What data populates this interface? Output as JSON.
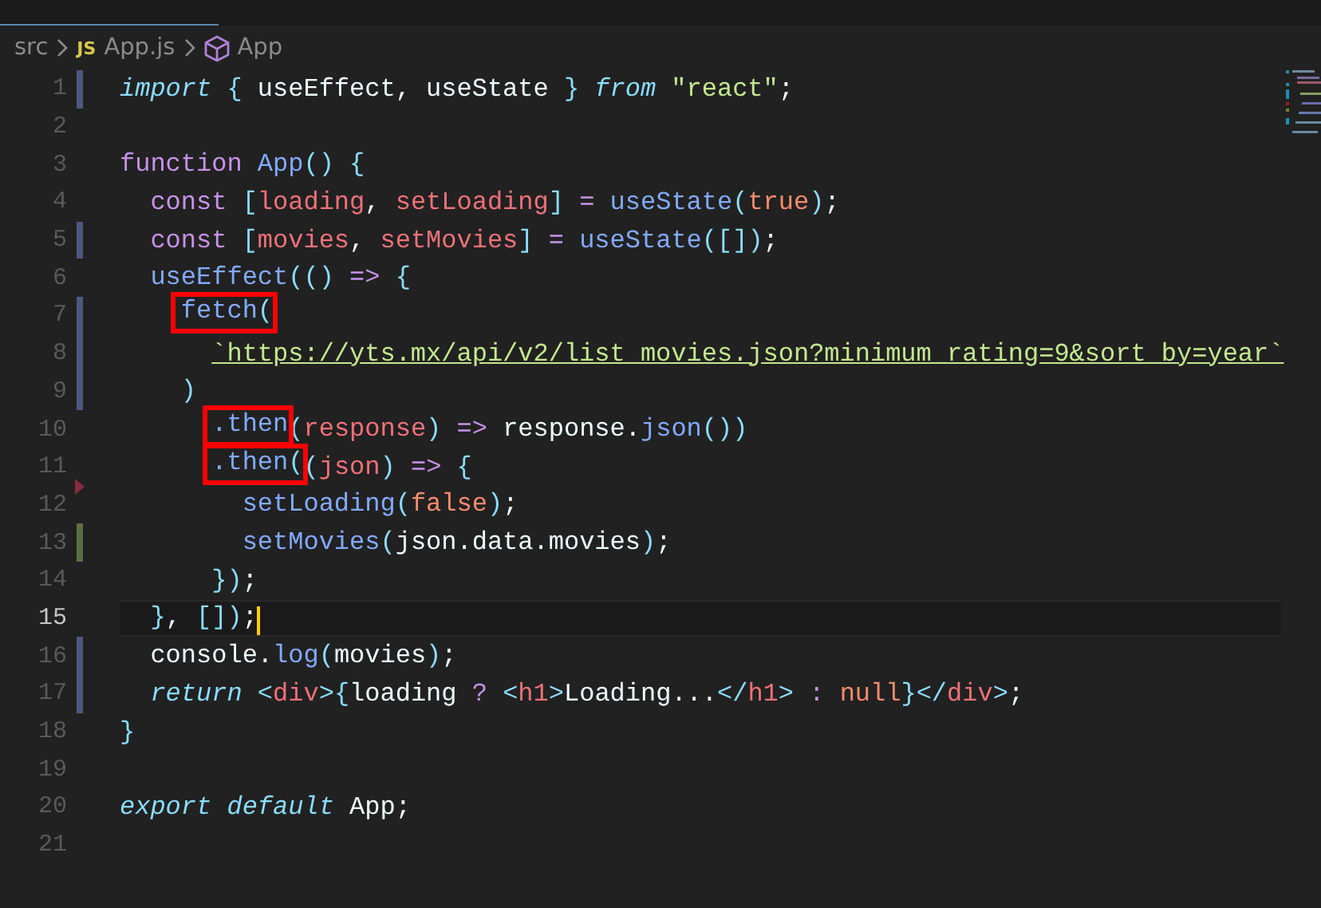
{
  "breadcrumb": [
    {
      "kind": "folder",
      "label": "src"
    },
    {
      "kind": "js-file",
      "icon": "JS",
      "label": "App.js"
    },
    {
      "kind": "component",
      "label": "App"
    }
  ],
  "lines": [
    {
      "number": "1",
      "modified": true,
      "added": false,
      "deleted": false,
      "current": false,
      "segments": [
        {
          "kind": "kw",
          "text": "import "
        },
        {
          "kind": "br",
          "text": "{ "
        },
        {
          "kind": "p",
          "text": "useEffect, useState "
        },
        {
          "kind": "br",
          "text": "} "
        },
        {
          "kind": "kw",
          "text": "from "
        },
        {
          "kind": "str",
          "text": "\"react\""
        },
        {
          "kind": "p",
          "text": ";"
        }
      ]
    },
    {
      "number": "2",
      "modified": false,
      "added": false,
      "deleted": false,
      "current": false
    },
    {
      "number": "3",
      "modified": false,
      "added": false,
      "deleted": false,
      "current": false,
      "segments": [
        {
          "kind": "st",
          "text": "function "
        },
        {
          "kind": "fn",
          "text": "App"
        },
        {
          "kind": "br",
          "text": "() {"
        }
      ]
    },
    {
      "number": "4",
      "modified": false,
      "added": false,
      "deleted": false,
      "current": false,
      "segments": [
        {
          "kind": "st",
          "text": "  const "
        },
        {
          "kind": "br",
          "text": "["
        },
        {
          "kind": "var",
          "text": "loading"
        },
        {
          "kind": "p",
          "text": ", "
        },
        {
          "kind": "var",
          "text": "setLoading"
        },
        {
          "kind": "br",
          "text": "]"
        },
        {
          "kind": "op",
          "text": " = "
        },
        {
          "kind": "fn",
          "text": "useState"
        },
        {
          "kind": "br",
          "text": "("
        },
        {
          "kind": "bool",
          "text": "true"
        },
        {
          "kind": "br",
          "text": ")"
        },
        {
          "kind": "p",
          "text": ";"
        }
      ]
    },
    {
      "number": "5",
      "modified": true,
      "added": false,
      "deleted": false,
      "current": false,
      "segments": [
        {
          "kind": "st",
          "text": "  const "
        },
        {
          "kind": "br",
          "text": "["
        },
        {
          "kind": "var",
          "text": "movies"
        },
        {
          "kind": "p",
          "text": ", "
        },
        {
          "kind": "var",
          "text": "setMovies"
        },
        {
          "kind": "br",
          "text": "]"
        },
        {
          "kind": "op",
          "text": " = "
        },
        {
          "kind": "fn",
          "text": "useState"
        },
        {
          "kind": "br",
          "text": "([])"
        },
        {
          "kind": "p",
          "text": ";"
        }
      ]
    },
    {
      "number": "6",
      "modified": false,
      "added": false,
      "deleted": false,
      "current": false,
      "segments": [
        {
          "kind": "fn",
          "text": "  useEffect"
        },
        {
          "kind": "br",
          "text": "(()"
        },
        {
          "kind": "op",
          "text": " => "
        },
        {
          "kind": "br",
          "text": "{"
        }
      ]
    },
    {
      "number": "7",
      "modified": true,
      "added": false,
      "deleted": false,
      "current": false,
      "boxed_segments": [
        {
          "kind": "fn",
          "text": "    fetch"
        },
        {
          "kind": "br",
          "text": "("
        }
      ]
    },
    {
      "number": "8",
      "modified": true,
      "added": false,
      "deleted": false,
      "current": false,
      "segments": [
        {
          "kind": "link",
          "text": "      `https://yts.mx/api/v2/list_movies.json?minimum_rating=9&sort_by=year`"
        }
      ]
    },
    {
      "number": "9",
      "modified": true,
      "added": false,
      "deleted": false,
      "current": false,
      "segments": [
        {
          "kind": "br",
          "text": "    )"
        }
      ]
    },
    {
      "number": "10",
      "modified": false,
      "added": false,
      "deleted": false,
      "current": false,
      "boxed_segments": [
        {
          "kind": "fn",
          "text": "      .then"
        }
      ],
      "after_segments": [
        {
          "kind": "br",
          "text": "("
        },
        {
          "kind": "var",
          "text": "response"
        },
        {
          "kind": "br",
          "text": ")"
        },
        {
          "kind": "op",
          "text": " => "
        },
        {
          "kind": "p",
          "text": "response."
        },
        {
          "kind": "fn",
          "text": "json"
        },
        {
          "kind": "br",
          "text": "())"
        }
      ]
    },
    {
      "number": "11",
      "modified": false,
      "added": false,
      "deleted": true,
      "current": false,
      "boxed_segments": [
        {
          "kind": "fn",
          "text": "      .then"
        },
        {
          "kind": "br",
          "text": "("
        }
      ],
      "after_segments": [
        {
          "kind": "br",
          "text": "("
        },
        {
          "kind": "var",
          "text": "json"
        },
        {
          "kind": "br",
          "text": ")"
        },
        {
          "kind": "op",
          "text": " => "
        },
        {
          "kind": "br",
          "text": "{"
        }
      ]
    },
    {
      "number": "12",
      "modified": false,
      "added": false,
      "deleted": false,
      "current": false,
      "segments": [
        {
          "kind": "fn",
          "text": "        setLoading"
        },
        {
          "kind": "br",
          "text": "("
        },
        {
          "kind": "bool",
          "text": "false"
        },
        {
          "kind": "br",
          "text": ")"
        },
        {
          "kind": "p",
          "text": ";"
        }
      ]
    },
    {
      "number": "13",
      "modified": false,
      "added": true,
      "deleted": false,
      "current": false,
      "segments": [
        {
          "kind": "fn",
          "text": "        setMovies"
        },
        {
          "kind": "br",
          "text": "("
        },
        {
          "kind": "p",
          "text": "json.data.movies"
        },
        {
          "kind": "br",
          "text": ")"
        },
        {
          "kind": "p",
          "text": ";"
        }
      ]
    },
    {
      "number": "14",
      "modified": false,
      "added": false,
      "deleted": false,
      "current": false,
      "segments": [
        {
          "kind": "br",
          "text": "      })"
        },
        {
          "kind": "p",
          "text": ";"
        }
      ]
    },
    {
      "number": "15",
      "modified": false,
      "added": false,
      "deleted": false,
      "current": true,
      "segments": [
        {
          "kind": "br",
          "text": "  }"
        },
        {
          "kind": "p",
          "text": ", "
        },
        {
          "kind": "br",
          "text": "[])"
        },
        {
          "kind": "p",
          "text": ";"
        }
      ]
    },
    {
      "number": "16",
      "modified": true,
      "added": false,
      "deleted": false,
      "current": false,
      "segments": [
        {
          "kind": "p",
          "text": "  console."
        },
        {
          "kind": "fn",
          "text": "log"
        },
        {
          "kind": "br",
          "text": "("
        },
        {
          "kind": "p",
          "text": "movies"
        },
        {
          "kind": "br",
          "text": ")"
        },
        {
          "kind": "p",
          "text": ";"
        }
      ]
    },
    {
      "number": "17",
      "modified": true,
      "added": false,
      "deleted": false,
      "current": false,
      "segments": [
        {
          "kind": "kw",
          "text": "  return "
        },
        {
          "kind": "br",
          "text": "<"
        },
        {
          "kind": "var",
          "text": "div"
        },
        {
          "kind": "br",
          "text": ">{"
        },
        {
          "kind": "p",
          "text": "loading "
        },
        {
          "kind": "op",
          "text": "? "
        },
        {
          "kind": "br",
          "text": "<"
        },
        {
          "kind": "var",
          "text": "h1"
        },
        {
          "kind": "br",
          "text": ">"
        },
        {
          "kind": "p",
          "text": "Loading..."
        },
        {
          "kind": "br",
          "text": "</"
        },
        {
          "kind": "var",
          "text": "h1"
        },
        {
          "kind": "br",
          "text": "> "
        },
        {
          "kind": "op",
          "text": ": "
        },
        {
          "kind": "bool",
          "text": "null"
        },
        {
          "kind": "br",
          "text": "}</"
        },
        {
          "kind": "var",
          "text": "div"
        },
        {
          "kind": "br",
          "text": ">"
        },
        {
          "kind": "p",
          "text": ";"
        }
      ]
    },
    {
      "number": "18",
      "modified": false,
      "added": false,
      "deleted": false,
      "current": false,
      "segments": [
        {
          "kind": "br",
          "text": "}"
        }
      ]
    },
    {
      "number": "19",
      "modified": false,
      "added": false,
      "deleted": false,
      "current": false
    },
    {
      "number": "20",
      "modified": false,
      "added": false,
      "deleted": false,
      "current": false,
      "segments": [
        {
          "kind": "kw",
          "text": "export default "
        },
        {
          "kind": "p",
          "text": "App;"
        }
      ]
    },
    {
      "number": "21",
      "modified": false,
      "added": false,
      "deleted": false,
      "current": false
    }
  ]
}
